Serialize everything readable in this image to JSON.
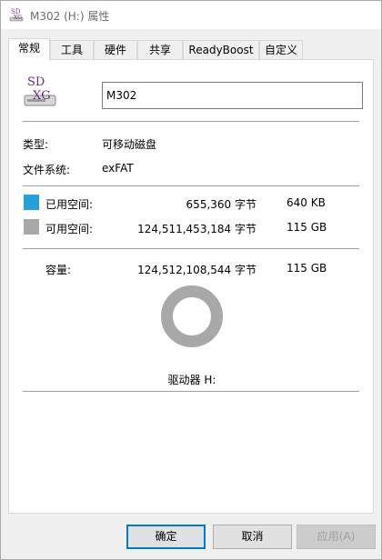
{
  "window": {
    "title": "M302 (H:) 属性"
  },
  "tabs": [
    {
      "label": "常规",
      "active": true
    },
    {
      "label": "工具"
    },
    {
      "label": "硬件"
    },
    {
      "label": "共享"
    },
    {
      "label": "ReadyBoost"
    },
    {
      "label": "自定义"
    }
  ],
  "drive_icon": {
    "text_top": "SD",
    "text_bottom": "XG",
    "icon": "sd-card-drive-icon"
  },
  "name_field": {
    "value": "M302"
  },
  "info": {
    "type_label": "类型:",
    "type_value": "可移动磁盘",
    "fs_label": "文件系统:",
    "fs_value": "exFAT"
  },
  "space": {
    "used_label": "已用空间:",
    "used_bytes": "655,360 字节",
    "used_size": "640 KB",
    "used_color": "#26a0da",
    "free_label": "可用空间:",
    "free_bytes": "124,511,453,184 字节",
    "free_size": "115 GB",
    "free_color": "#a8a8a8",
    "capacity_label": "容量:",
    "capacity_bytes": "124,512,108,544 字节",
    "capacity_size": "115 GB"
  },
  "drive_label": "驱动器 H:",
  "buttons": {
    "ok": "确定",
    "cancel": "取消",
    "apply": "应用(A)"
  }
}
